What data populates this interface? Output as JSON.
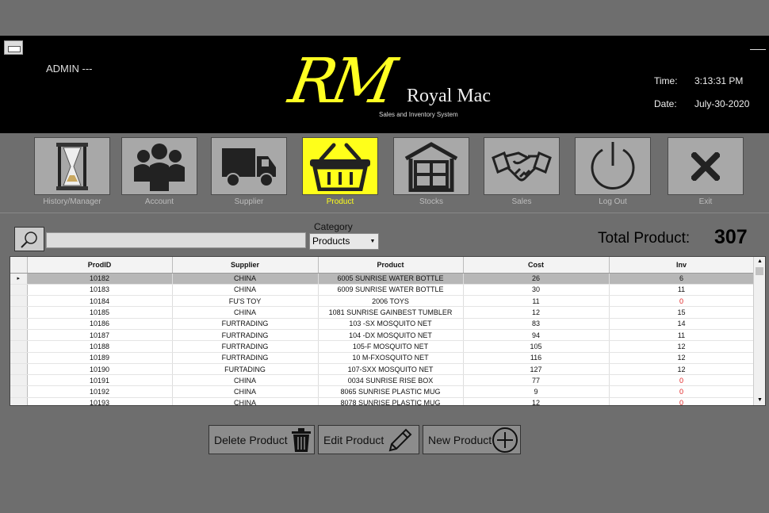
{
  "header": {
    "user": "ADMIN ---",
    "logo_initials": "RM",
    "logo_name": "Royal Mac",
    "logo_subtitle": "Sales and Inventory System",
    "time_label": "Time:",
    "time_value": "3:13:31  PM",
    "date_label": "Date:",
    "date_value": "July-30-2020"
  },
  "nav": [
    {
      "label": "History/Manager",
      "icon": "hourglass-icon"
    },
    {
      "label": "Account",
      "icon": "users-icon"
    },
    {
      "label": "Supplier",
      "icon": "truck-icon"
    },
    {
      "label": "Product",
      "icon": "basket-icon",
      "active": true
    },
    {
      "label": "Stocks",
      "icon": "warehouse-icon"
    },
    {
      "label": "Sales",
      "icon": "handshake-icon"
    },
    {
      "label": "Log Out",
      "icon": "power-icon"
    },
    {
      "label": "Exit",
      "icon": "close-icon"
    }
  ],
  "filter": {
    "search_value": "",
    "category_label": "Category",
    "category_selected": "Products",
    "total_label": "Total Product:",
    "total_value": "307"
  },
  "table": {
    "columns": [
      "ProdID",
      "Supplier",
      "Product",
      "Cost",
      "Inv"
    ],
    "rows": [
      [
        "10182",
        "CHINA",
        "6005 SUNRISE WATER BOTTLE",
        "26",
        "6"
      ],
      [
        "10183",
        "CHINA",
        "6009 SUNRISE WATER BOTTLE",
        "30",
        "11"
      ],
      [
        "10184",
        "FU'S TOY",
        "2006 TOYS",
        "11",
        "0"
      ],
      [
        "10185",
        "CHINA",
        "1081 SUNRISE GAINBEST TUMBLER",
        "12",
        "15"
      ],
      [
        "10186",
        "FURTRADING",
        "103 -SX MOSQUITO NET",
        "83",
        "14"
      ],
      [
        "10187",
        "FURTRADING",
        "104 -DX MOSQUITO NET",
        "94",
        "11"
      ],
      [
        "10188",
        "FURTRADING",
        "105-F MOSQUITO NET",
        "105",
        "12"
      ],
      [
        "10189",
        "FURTRADING",
        "10 M-FXOSQUITO NET",
        "116",
        "12"
      ],
      [
        "10190",
        "FURTADING",
        "107-SXX MOSQUITO NET",
        "127",
        "12"
      ],
      [
        "10191",
        "CHINA",
        "0034 SUNRISE RISE BOX",
        "77",
        "0"
      ],
      [
        "10192",
        "CHINA",
        "8065 SUNRISE PLASTIC MUG",
        "9",
        "0"
      ],
      [
        "10193",
        "CHINA",
        "8078 SUNRISE PLASTIC MUG",
        "12",
        "0"
      ]
    ],
    "selected_row": 0
  },
  "actions": {
    "delete_label": "Delete Product",
    "edit_label": "Edit Product",
    "new_label": "New Product"
  },
  "colors": {
    "accent": "#ffff1a",
    "zero_stock": "#e02020"
  }
}
